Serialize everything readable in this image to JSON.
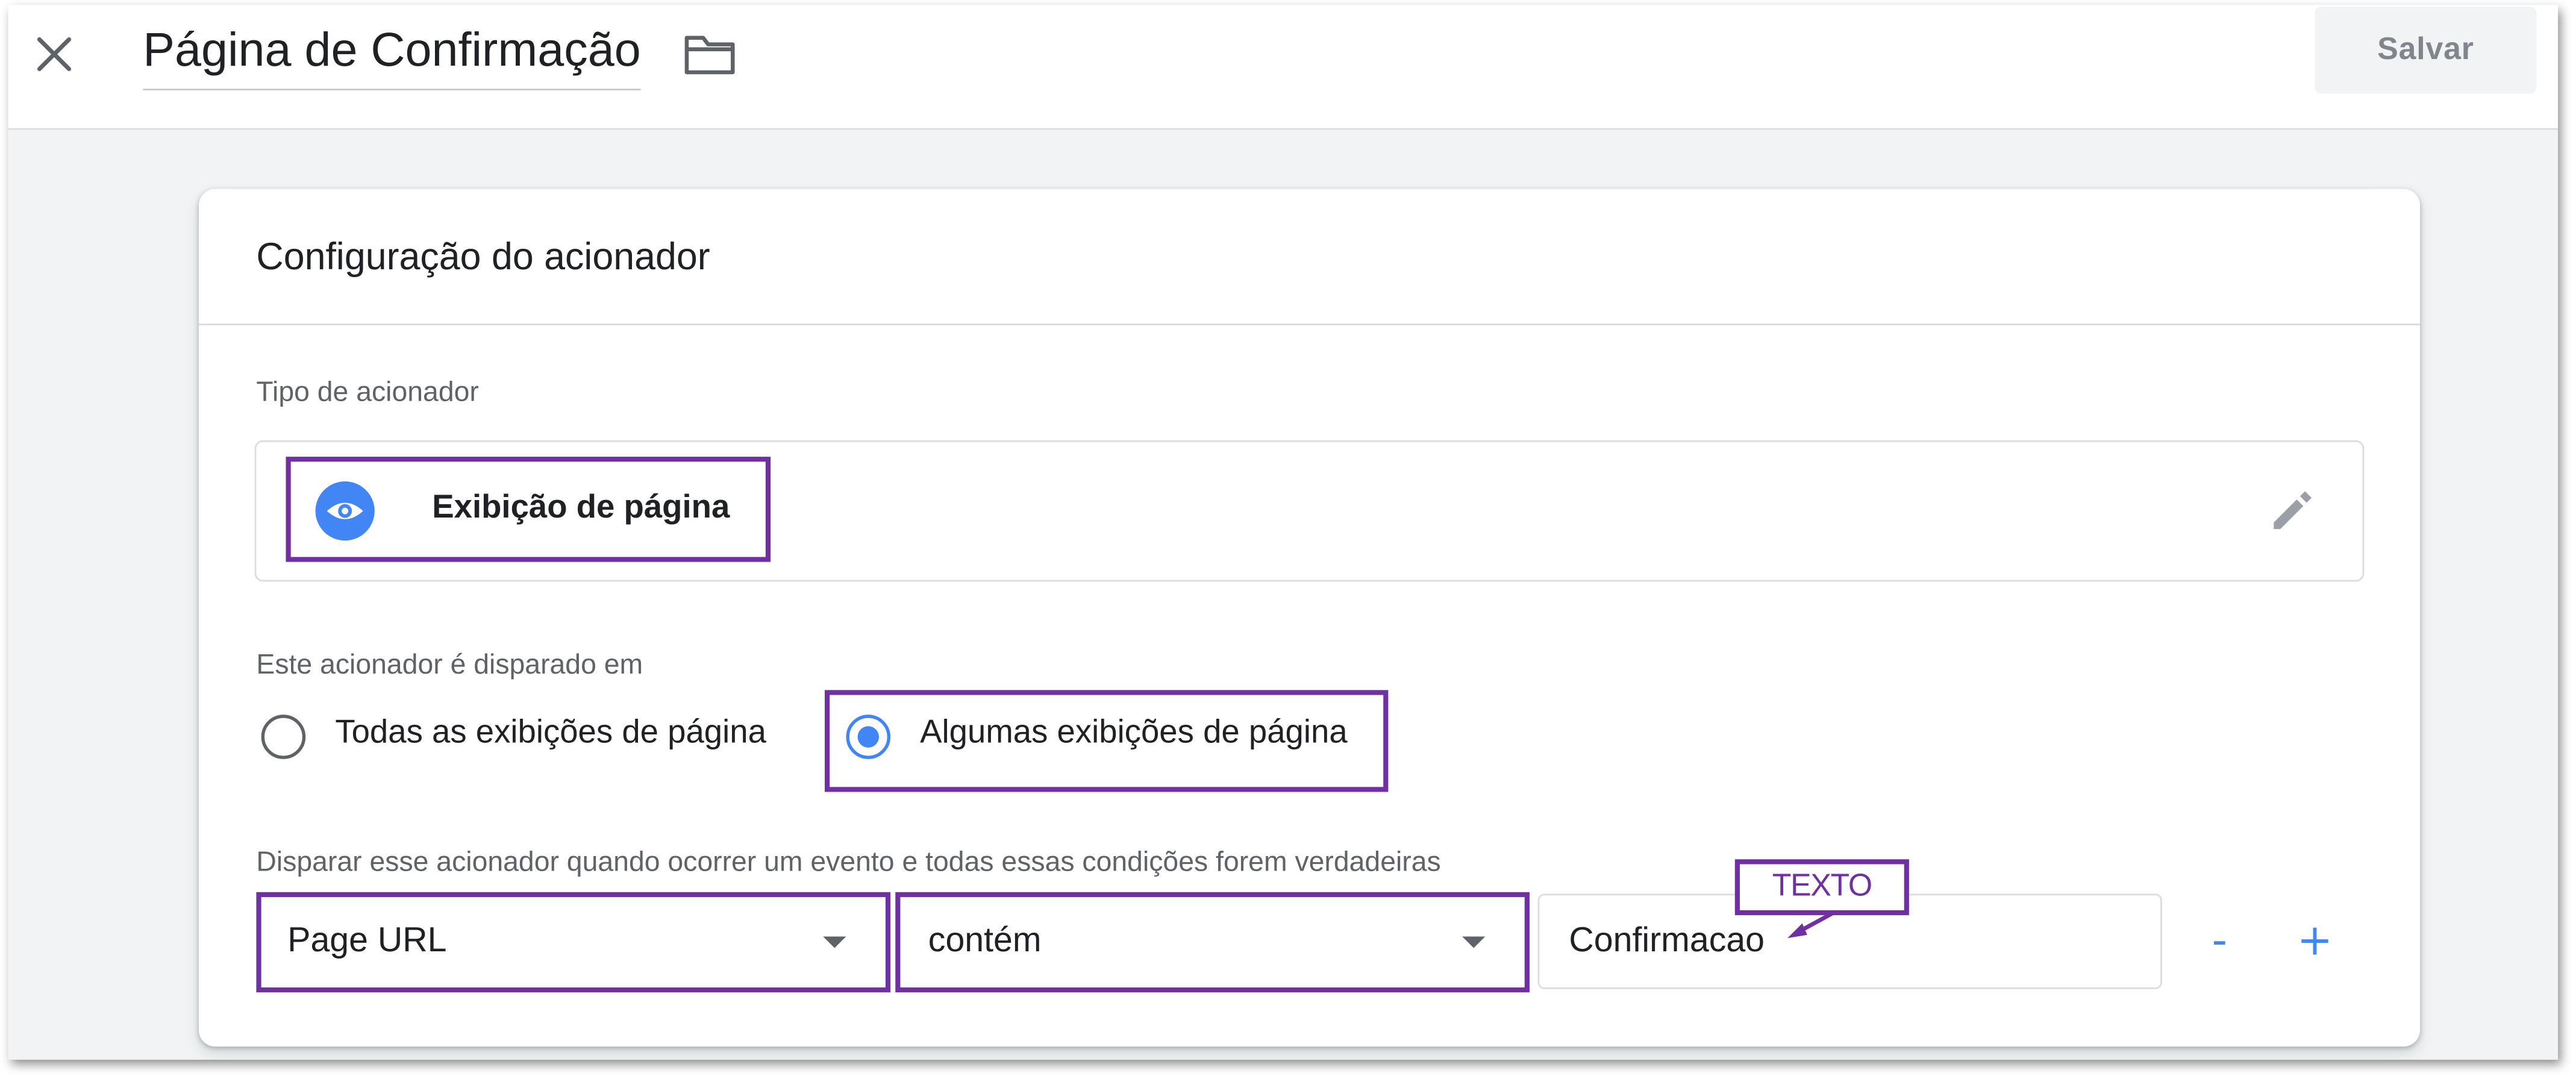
{
  "header": {
    "title": "Página de Confirmação",
    "save_label": "Salvar",
    "close_icon": "close-icon",
    "folder_icon": "folder-icon"
  },
  "trigger_config": {
    "card_title": "Configuração do acionador",
    "type_label": "Tipo de acionador",
    "type_name": "Exibição de página",
    "type_icon": "eye-icon",
    "edit_icon": "pencil-icon",
    "fires_on_label": "Este acionador é disparado em",
    "options": [
      {
        "label": "Todas as exibições de página",
        "selected": false
      },
      {
        "label": "Algumas exibições de página",
        "selected": true
      }
    ],
    "condition_label": "Disparar esse acionador quando ocorrer um evento e todas essas condições forem verdadeiras",
    "condition": {
      "variable": "Page URL",
      "operator": "contém",
      "value": "Confirmacao"
    },
    "remove_label": "-",
    "add_label": "+"
  },
  "annotation": {
    "label": "TEXTO"
  },
  "colors": {
    "accent_blue": "#4285f4",
    "highlight_purple": "#7030a0",
    "page_background": "#f1f3f4"
  }
}
